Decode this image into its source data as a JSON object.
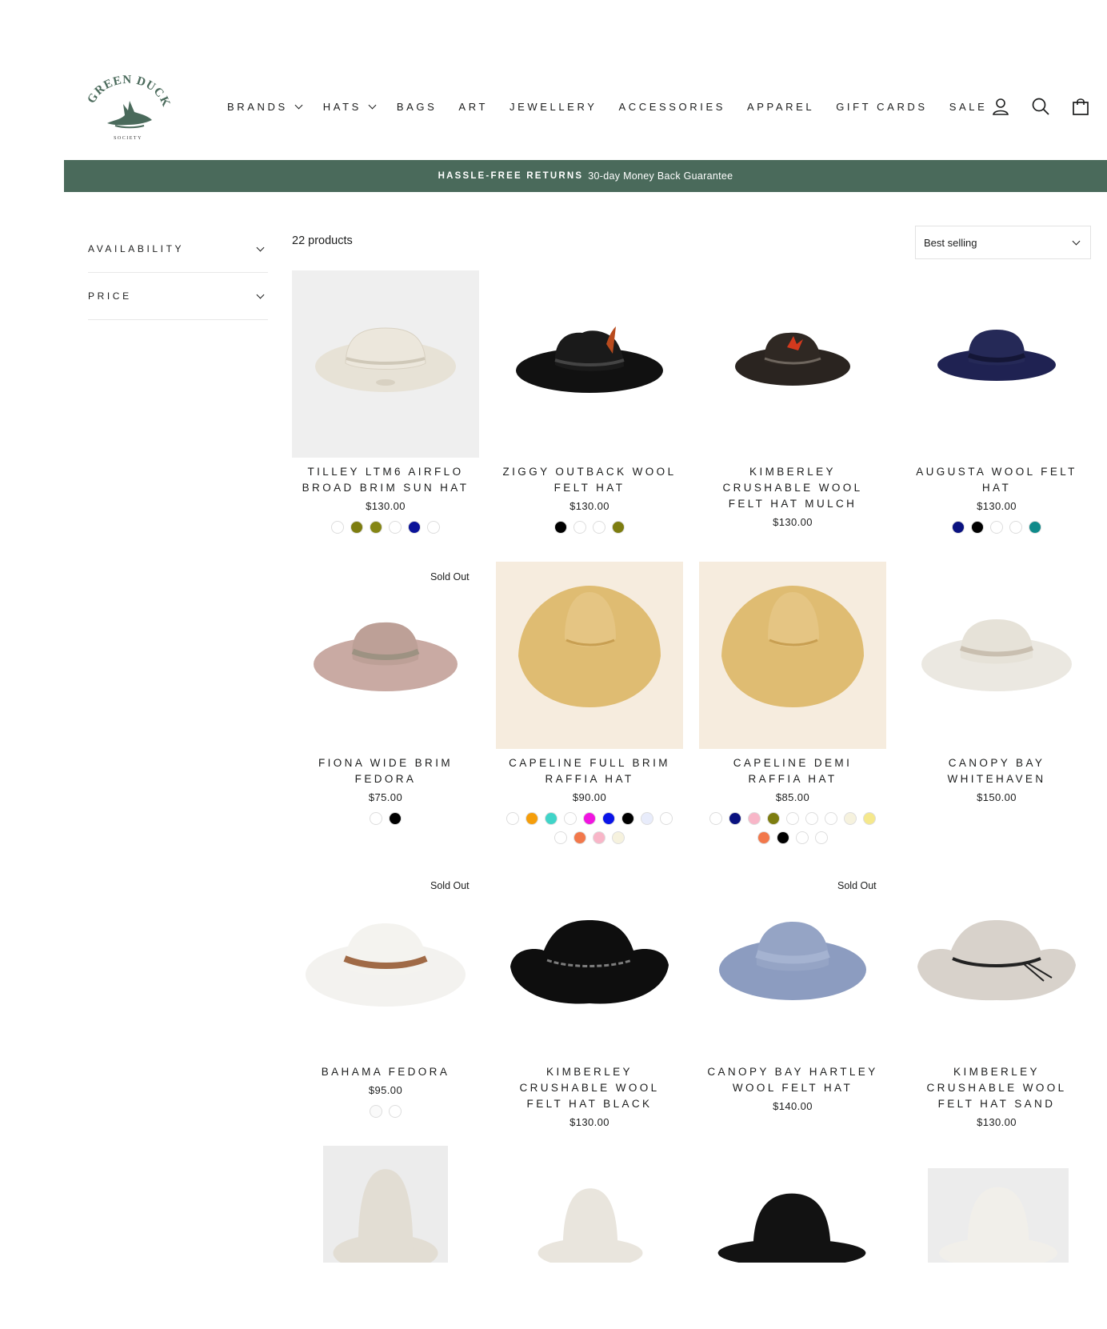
{
  "brand": {
    "logo_text": "GREEN DUCK",
    "logo_sub": "SOCIETY",
    "color": "#4a6a5b"
  },
  "nav": [
    {
      "label": "BRANDS",
      "has_dropdown": true
    },
    {
      "label": "HATS",
      "has_dropdown": true
    },
    {
      "label": "BAGS",
      "has_dropdown": false
    },
    {
      "label": "ART",
      "has_dropdown": false
    },
    {
      "label": "JEWELLERY",
      "has_dropdown": false
    },
    {
      "label": "ACCESSORIES",
      "has_dropdown": false
    },
    {
      "label": "APPAREL",
      "has_dropdown": false
    },
    {
      "label": "GIFT CARDS",
      "has_dropdown": false
    },
    {
      "label": "SALE",
      "has_dropdown": false
    }
  ],
  "header_icons": [
    "account-icon",
    "search-icon",
    "cart-icon"
  ],
  "announcement": {
    "strong": "HASSLE-FREE RETURNS",
    "rest": "30-day Money Back Guarantee"
  },
  "filters": [
    {
      "label": "AVAILABILITY"
    },
    {
      "label": "PRICE"
    }
  ],
  "product_count": "22 products",
  "sort": {
    "selected": "Best selling"
  },
  "products": [
    {
      "title": "TILLEY LTM6 AIRFLO BROAD BRIM SUN HAT",
      "price": "$130.00",
      "sold_out": false,
      "swatches": [
        "#ffffff",
        "#7d7d10",
        "#858615",
        "#ffffff",
        "#0a1299",
        "#ffffff"
      ]
    },
    {
      "title": "ZIGGY OUTBACK WOOL FELT HAT",
      "price": "$130.00",
      "sold_out": false,
      "swatches": [
        "#000000",
        "#ffffff",
        "#ffffff",
        "#7d7d10"
      ]
    },
    {
      "title": "KIMBERLEY CRUSHABLE WOOL FELT HAT MULCH",
      "price": "$130.00",
      "sold_out": false,
      "swatches": []
    },
    {
      "title": "AUGUSTA WOOL FELT HAT",
      "price": "$130.00",
      "sold_out": false,
      "swatches": [
        "#0a1280",
        "#000000",
        "#ffffff",
        "#ffffff",
        "#0f8a8a"
      ]
    },
    {
      "title": "FIONA WIDE BRIM FEDORA",
      "price": "$75.00",
      "sold_out": true,
      "sold_label": "Sold Out",
      "swatches": [
        "#ffffff",
        "#000000"
      ]
    },
    {
      "title": "CAPELINE FULL BRIM RAFFIA HAT",
      "price": "$90.00",
      "sold_out": false,
      "swatches": [
        "#ffffff",
        "#f59e0b",
        "#40d4c8",
        "#ffffff",
        "#f015e0",
        "#0a14e8",
        "#000000",
        "#e8ecfb",
        "#ffffff",
        "#ffffff",
        "#f2784b",
        "#f8b6c8",
        "#f6f2de"
      ]
    },
    {
      "title": "CAPELINE DEMI RAFFIA HAT",
      "price": "$85.00",
      "sold_out": false,
      "swatches": [
        "#ffffff",
        "#0a1280",
        "#f8b6c8",
        "#7d7d10",
        "#ffffff",
        "#ffffff",
        "#ffffff",
        "#f6f2de",
        "#f5e88c",
        "#f2784b",
        "#000000",
        "#ffffff",
        "#ffffff"
      ]
    },
    {
      "title": "CANOPY BAY WHITEHAVEN",
      "price": "$150.00",
      "sold_out": false,
      "swatches": []
    },
    {
      "title": "BAHAMA FEDORA",
      "price": "$95.00",
      "sold_out": true,
      "sold_label": "Sold Out",
      "swatches": [
        "#fafafa",
        "#ffffff"
      ]
    },
    {
      "title": "KIMBERLEY CRUSHABLE WOOL FELT HAT BLACK",
      "price": "$130.00",
      "sold_out": false,
      "swatches": []
    },
    {
      "title": "CANOPY BAY HARTLEY WOOL FELT HAT",
      "price": "$140.00",
      "sold_out": true,
      "sold_label": "Sold Out",
      "swatches": []
    },
    {
      "title": "KIMBERLEY CRUSHABLE WOOL FELT HAT SAND",
      "price": "$130.00",
      "sold_out": false,
      "swatches": []
    }
  ]
}
